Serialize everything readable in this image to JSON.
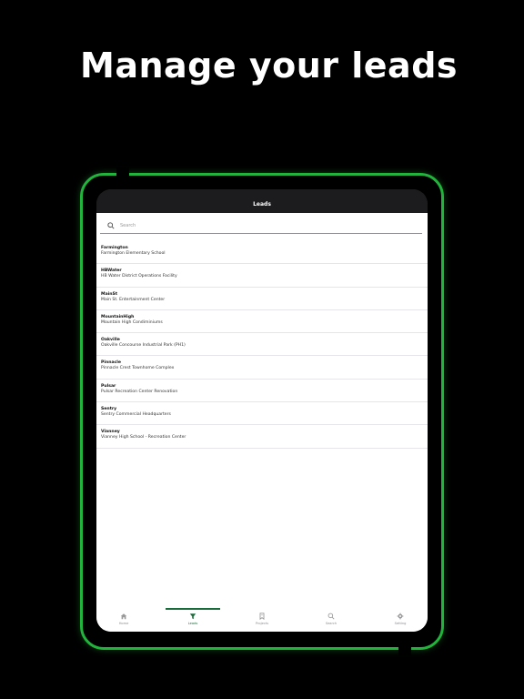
{
  "headline": "Manage your leads",
  "nav": {
    "title": "Leads"
  },
  "search": {
    "placeholder": "Search",
    "value": ""
  },
  "leads": [
    {
      "code": "Farmington",
      "name": "Farmington Elementary School"
    },
    {
      "code": "HBWater",
      "name": "HB Water District Operations Facility"
    },
    {
      "code": "MainSt",
      "name": "Main St. Entertainment Center"
    },
    {
      "code": "MountainHigh",
      "name": "Mountain High Condiminiums"
    },
    {
      "code": "Oakville",
      "name": "Oakville Concourse Industrial Park (PH1)"
    },
    {
      "code": "Pinnacle",
      "name": "Pinnacle Crest Townhome Complex"
    },
    {
      "code": "Pulsar",
      "name": "Pulsar Recreation Center Renovation"
    },
    {
      "code": "Sentry",
      "name": "Sentry Commercial Headquarters"
    },
    {
      "code": "Vianney",
      "name": "Vianney High School - Recreation Center"
    }
  ],
  "tabs": [
    {
      "label": "Home",
      "icon": "home-icon"
    },
    {
      "label": "Leads",
      "icon": "filter-icon",
      "active": true
    },
    {
      "label": "Projects",
      "icon": "bookmark-icon"
    },
    {
      "label": "Search",
      "icon": "search-icon"
    },
    {
      "label": "Setting",
      "icon": "gear-icon"
    }
  ],
  "colors": {
    "accent": "#1a6b3a",
    "frame_glow": "#21b33c",
    "background": "#000000"
  }
}
